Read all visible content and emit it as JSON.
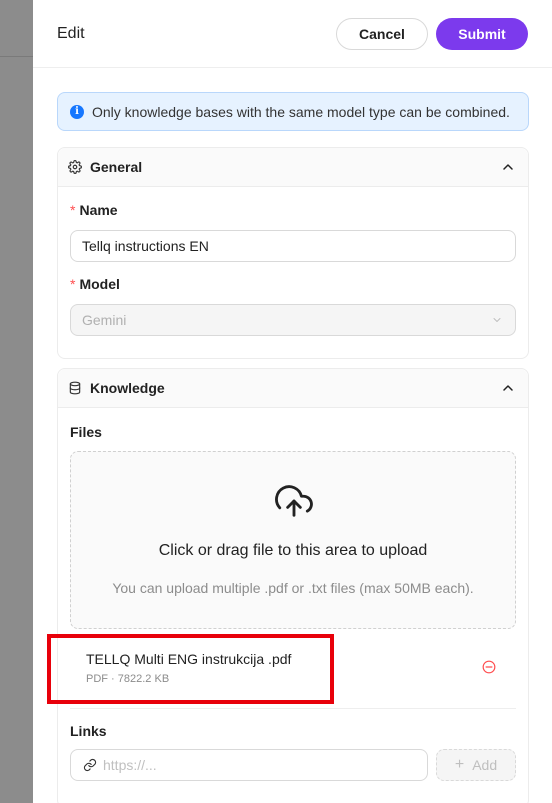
{
  "header": {
    "title": "Edit",
    "cancel_label": "Cancel",
    "submit_label": "Submit"
  },
  "info_banner": {
    "text": "Only knowledge bases with the same model type can be combined."
  },
  "general": {
    "title": "General",
    "name_label": "Name",
    "name_value": "Tellq instructions EN",
    "model_label": "Model",
    "model_value": "Gemini"
  },
  "knowledge": {
    "title": "Knowledge",
    "files_label": "Files",
    "dropzone_text": "Click or drag file to this area to upload",
    "dropzone_hint": "You can upload multiple .pdf or .txt files (max 50MB each).",
    "files": [
      {
        "name": "TELLQ Multi ENG instrukcija .pdf",
        "meta": "PDF · 7822.2 KB"
      }
    ],
    "links_label": "Links",
    "link_placeholder": "https://...",
    "add_label": "Add"
  },
  "colors": {
    "accent": "#7c3aed",
    "info_bg": "#e6f2ff",
    "required": "#ff4d4f",
    "highlight": "#e8000a",
    "remove": "#ff4d4f"
  }
}
